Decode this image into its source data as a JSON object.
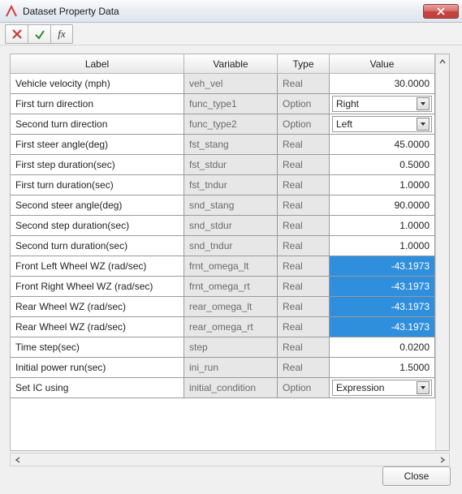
{
  "window": {
    "title": "Dataset Property Data"
  },
  "toolbar": {
    "cancel_tip": "Cancel",
    "accept_tip": "Accept",
    "fx_label": "fx"
  },
  "colors": {
    "highlight_bg": "#2f8fdd",
    "highlight_fg": "#ffffff"
  },
  "columns": {
    "label": "Label",
    "variable": "Variable",
    "type": "Type",
    "value": "Value"
  },
  "types": {
    "real": "Real",
    "option": "Option"
  },
  "rows": [
    {
      "label": "Vehicle velocity (mph)",
      "variable": "veh_vel",
      "type": "real",
      "value": "30.0000",
      "highlight": false
    },
    {
      "label": "First turn direction",
      "variable": "func_type1",
      "type": "option",
      "value": "Right",
      "highlight": false
    },
    {
      "label": "Second turn direction",
      "variable": "func_type2",
      "type": "option",
      "value": "Left",
      "highlight": false
    },
    {
      "label": "First steer angle(deg)",
      "variable": "fst_stang",
      "type": "real",
      "value": "45.0000",
      "highlight": false
    },
    {
      "label": "First step duration(sec)",
      "variable": "fst_stdur",
      "type": "real",
      "value": "0.5000",
      "highlight": false
    },
    {
      "label": "First turn duration(sec)",
      "variable": "fst_tndur",
      "type": "real",
      "value": "1.0000",
      "highlight": false
    },
    {
      "label": "Second steer angle(deg)",
      "variable": "snd_stang",
      "type": "real",
      "value": "90.0000",
      "highlight": false
    },
    {
      "label": "Second step duration(sec)",
      "variable": "snd_stdur",
      "type": "real",
      "value": "1.0000",
      "highlight": false
    },
    {
      "label": "Second turn duration(sec)",
      "variable": "snd_tndur",
      "type": "real",
      "value": "1.0000",
      "highlight": false
    },
    {
      "label": "Front Left Wheel WZ (rad/sec)",
      "variable": "frnt_omega_lt",
      "type": "real",
      "value": "-43.1973",
      "highlight": true
    },
    {
      "label": "Front Right Wheel WZ (rad/sec)",
      "variable": "frnt_omega_rt",
      "type": "real",
      "value": "-43.1973",
      "highlight": true
    },
    {
      "label": "Rear Wheel WZ (rad/sec)",
      "variable": "rear_omega_lt",
      "type": "real",
      "value": "-43.1973",
      "highlight": true
    },
    {
      "label": "Rear Wheel WZ (rad/sec)",
      "variable": "rear_omega_rt",
      "type": "real",
      "value": "-43.1973",
      "highlight": true
    },
    {
      "label": "Time step(sec)",
      "variable": "step",
      "type": "real",
      "value": "0.0200",
      "highlight": false
    },
    {
      "label": "Initial power run(sec)",
      "variable": "ini_run",
      "type": "real",
      "value": "1.5000",
      "highlight": false
    },
    {
      "label": "Set IC using",
      "variable": "initial_condition",
      "type": "option",
      "value": "Expression",
      "highlight": false
    }
  ],
  "footer": {
    "close_label": "Close"
  }
}
